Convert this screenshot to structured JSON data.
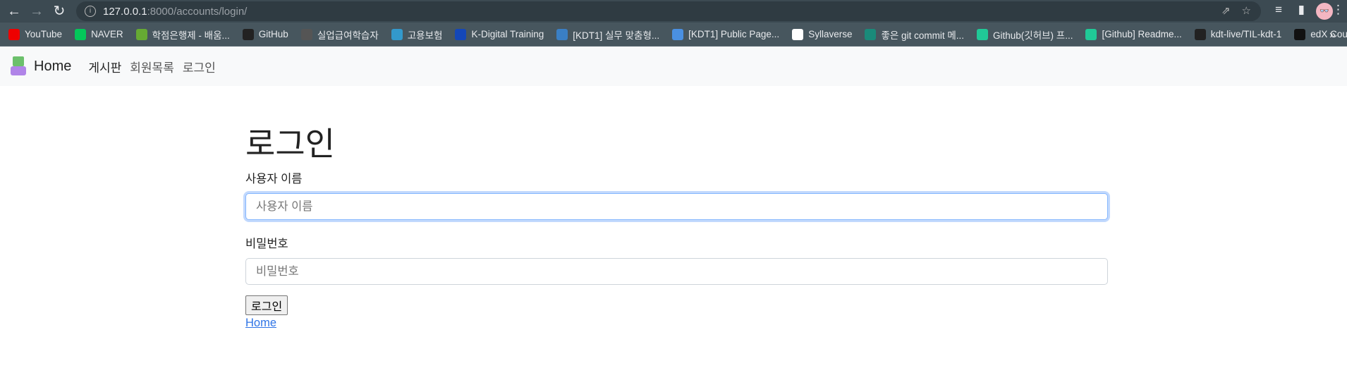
{
  "browser": {
    "url_host": "127.0.0.1",
    "url_path": ":8000/accounts/login/",
    "bookmarks": [
      {
        "label": "YouTube",
        "icon": "youtube-icon",
        "color": "#e00"
      },
      {
        "label": "NAVER",
        "icon": "naver-icon",
        "color": "#03c75a"
      },
      {
        "label": "학점은행제 - 배움...",
        "icon": "tree-icon",
        "color": "#6a3"
      },
      {
        "label": "GitHub",
        "icon": "github-icon",
        "color": "#222"
      },
      {
        "label": "실업급여학습자",
        "icon": "globe-icon",
        "color": "#555"
      },
      {
        "label": "고용보험",
        "icon": "employment-icon",
        "color": "#39c"
      },
      {
        "label": "K-Digital Training",
        "icon": "kdigital-icon",
        "color": "#1447b8"
      },
      {
        "label": "[KDT1] 실무 맞춤형...",
        "icon": "one-icon",
        "color": "#3a7fc4"
      },
      {
        "label": "[KDT1] Public Page...",
        "icon": "folder-icon",
        "color": "#4a90e2"
      },
      {
        "label": "Syllaverse",
        "icon": "syllaverse-icon",
        "color": "#fff"
      },
      {
        "label": "좋은 git commit 메...",
        "icon": "site-icon",
        "color": "#1a8a7a"
      },
      {
        "label": "Github(깃허브) 프...",
        "icon": "velog-icon",
        "color": "#20c997"
      },
      {
        "label": "[Github] Readme...",
        "icon": "velog-icon",
        "color": "#20c997"
      },
      {
        "label": "kdt-live/TIL-kdt-1",
        "icon": "github-icon",
        "color": "#222"
      },
      {
        "label": "edX Courses | View...",
        "icon": "edx-icon",
        "color": "#111"
      }
    ]
  },
  "navbar": {
    "brand": "Home",
    "links": [
      "게시판",
      "회원목록",
      "로그인"
    ]
  },
  "page": {
    "title": "로그인",
    "username_label": "사용자 이름",
    "username_placeholder": "사용자 이름",
    "password_label": "비밀번호",
    "password_placeholder": "비밀번호",
    "submit": "로그인",
    "home_link": "Home"
  }
}
